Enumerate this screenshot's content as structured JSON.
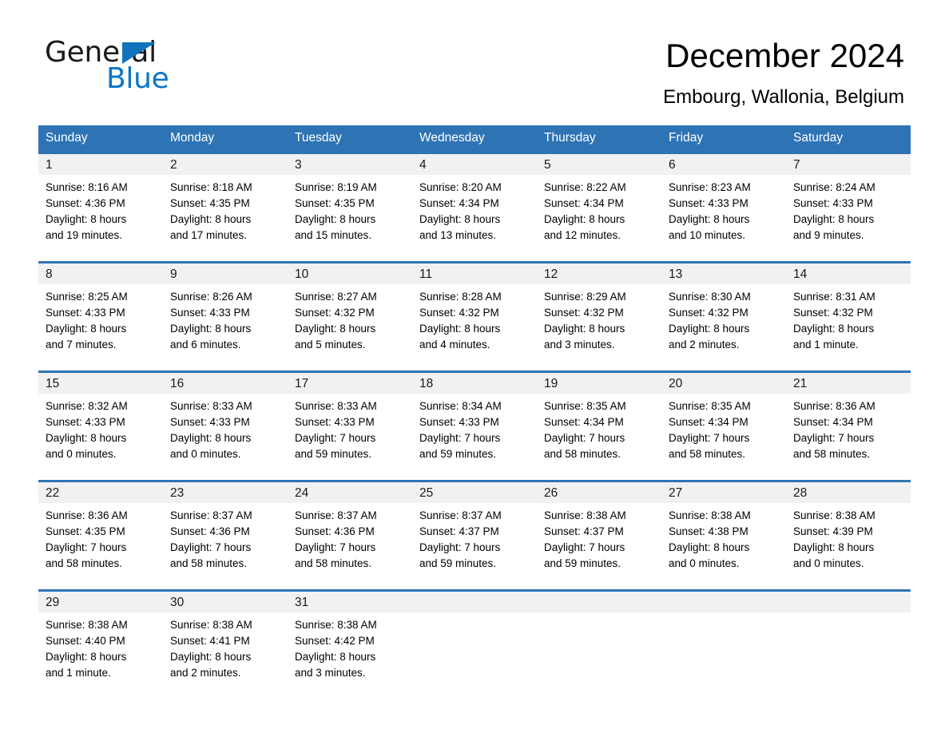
{
  "logo": {
    "word_one": "General",
    "word_two": "Blue",
    "triangle_color": "#1273bd",
    "blue_color": "#0b76c6"
  },
  "header": {
    "month_title": "December 2024",
    "location": "Embourg, Wallonia, Belgium"
  },
  "theme": {
    "header_blue": "#2e74b5",
    "daynum_band": "#f1f1f1",
    "text": "#000000"
  },
  "weekdays": [
    "Sunday",
    "Monday",
    "Tuesday",
    "Wednesday",
    "Thursday",
    "Friday",
    "Saturday"
  ],
  "weeks": [
    [
      {
        "day": "1",
        "sunrise": "Sunrise: 8:16 AM",
        "sunset": "Sunset: 4:36 PM",
        "daylight_1": "Daylight: 8 hours",
        "daylight_2": "and 19 minutes."
      },
      {
        "day": "2",
        "sunrise": "Sunrise: 8:18 AM",
        "sunset": "Sunset: 4:35 PM",
        "daylight_1": "Daylight: 8 hours",
        "daylight_2": "and 17 minutes."
      },
      {
        "day": "3",
        "sunrise": "Sunrise: 8:19 AM",
        "sunset": "Sunset: 4:35 PM",
        "daylight_1": "Daylight: 8 hours",
        "daylight_2": "and 15 minutes."
      },
      {
        "day": "4",
        "sunrise": "Sunrise: 8:20 AM",
        "sunset": "Sunset: 4:34 PM",
        "daylight_1": "Daylight: 8 hours",
        "daylight_2": "and 13 minutes."
      },
      {
        "day": "5",
        "sunrise": "Sunrise: 8:22 AM",
        "sunset": "Sunset: 4:34 PM",
        "daylight_1": "Daylight: 8 hours",
        "daylight_2": "and 12 minutes."
      },
      {
        "day": "6",
        "sunrise": "Sunrise: 8:23 AM",
        "sunset": "Sunset: 4:33 PM",
        "daylight_1": "Daylight: 8 hours",
        "daylight_2": "and 10 minutes."
      },
      {
        "day": "7",
        "sunrise": "Sunrise: 8:24 AM",
        "sunset": "Sunset: 4:33 PM",
        "daylight_1": "Daylight: 8 hours",
        "daylight_2": "and 9 minutes."
      }
    ],
    [
      {
        "day": "8",
        "sunrise": "Sunrise: 8:25 AM",
        "sunset": "Sunset: 4:33 PM",
        "daylight_1": "Daylight: 8 hours",
        "daylight_2": "and 7 minutes."
      },
      {
        "day": "9",
        "sunrise": "Sunrise: 8:26 AM",
        "sunset": "Sunset: 4:33 PM",
        "daylight_1": "Daylight: 8 hours",
        "daylight_2": "and 6 minutes."
      },
      {
        "day": "10",
        "sunrise": "Sunrise: 8:27 AM",
        "sunset": "Sunset: 4:32 PM",
        "daylight_1": "Daylight: 8 hours",
        "daylight_2": "and 5 minutes."
      },
      {
        "day": "11",
        "sunrise": "Sunrise: 8:28 AM",
        "sunset": "Sunset: 4:32 PM",
        "daylight_1": "Daylight: 8 hours",
        "daylight_2": "and 4 minutes."
      },
      {
        "day": "12",
        "sunrise": "Sunrise: 8:29 AM",
        "sunset": "Sunset: 4:32 PM",
        "daylight_1": "Daylight: 8 hours",
        "daylight_2": "and 3 minutes."
      },
      {
        "day": "13",
        "sunrise": "Sunrise: 8:30 AM",
        "sunset": "Sunset: 4:32 PM",
        "daylight_1": "Daylight: 8 hours",
        "daylight_2": "and 2 minutes."
      },
      {
        "day": "14",
        "sunrise": "Sunrise: 8:31 AM",
        "sunset": "Sunset: 4:32 PM",
        "daylight_1": "Daylight: 8 hours",
        "daylight_2": "and 1 minute."
      }
    ],
    [
      {
        "day": "15",
        "sunrise": "Sunrise: 8:32 AM",
        "sunset": "Sunset: 4:33 PM",
        "daylight_1": "Daylight: 8 hours",
        "daylight_2": "and 0 minutes."
      },
      {
        "day": "16",
        "sunrise": "Sunrise: 8:33 AM",
        "sunset": "Sunset: 4:33 PM",
        "daylight_1": "Daylight: 8 hours",
        "daylight_2": "and 0 minutes."
      },
      {
        "day": "17",
        "sunrise": "Sunrise: 8:33 AM",
        "sunset": "Sunset: 4:33 PM",
        "daylight_1": "Daylight: 7 hours",
        "daylight_2": "and 59 minutes."
      },
      {
        "day": "18",
        "sunrise": "Sunrise: 8:34 AM",
        "sunset": "Sunset: 4:33 PM",
        "daylight_1": "Daylight: 7 hours",
        "daylight_2": "and 59 minutes."
      },
      {
        "day": "19",
        "sunrise": "Sunrise: 8:35 AM",
        "sunset": "Sunset: 4:34 PM",
        "daylight_1": "Daylight: 7 hours",
        "daylight_2": "and 58 minutes."
      },
      {
        "day": "20",
        "sunrise": "Sunrise: 8:35 AM",
        "sunset": "Sunset: 4:34 PM",
        "daylight_1": "Daylight: 7 hours",
        "daylight_2": "and 58 minutes."
      },
      {
        "day": "21",
        "sunrise": "Sunrise: 8:36 AM",
        "sunset": "Sunset: 4:34 PM",
        "daylight_1": "Daylight: 7 hours",
        "daylight_2": "and 58 minutes."
      }
    ],
    [
      {
        "day": "22",
        "sunrise": "Sunrise: 8:36 AM",
        "sunset": "Sunset: 4:35 PM",
        "daylight_1": "Daylight: 7 hours",
        "daylight_2": "and 58 minutes."
      },
      {
        "day": "23",
        "sunrise": "Sunrise: 8:37 AM",
        "sunset": "Sunset: 4:36 PM",
        "daylight_1": "Daylight: 7 hours",
        "daylight_2": "and 58 minutes."
      },
      {
        "day": "24",
        "sunrise": "Sunrise: 8:37 AM",
        "sunset": "Sunset: 4:36 PM",
        "daylight_1": "Daylight: 7 hours",
        "daylight_2": "and 58 minutes."
      },
      {
        "day": "25",
        "sunrise": "Sunrise: 8:37 AM",
        "sunset": "Sunset: 4:37 PM",
        "daylight_1": "Daylight: 7 hours",
        "daylight_2": "and 59 minutes."
      },
      {
        "day": "26",
        "sunrise": "Sunrise: 8:38 AM",
        "sunset": "Sunset: 4:37 PM",
        "daylight_1": "Daylight: 7 hours",
        "daylight_2": "and 59 minutes."
      },
      {
        "day": "27",
        "sunrise": "Sunrise: 8:38 AM",
        "sunset": "Sunset: 4:38 PM",
        "daylight_1": "Daylight: 8 hours",
        "daylight_2": "and 0 minutes."
      },
      {
        "day": "28",
        "sunrise": "Sunrise: 8:38 AM",
        "sunset": "Sunset: 4:39 PM",
        "daylight_1": "Daylight: 8 hours",
        "daylight_2": "and 0 minutes."
      }
    ],
    [
      {
        "day": "29",
        "sunrise": "Sunrise: 8:38 AM",
        "sunset": "Sunset: 4:40 PM",
        "daylight_1": "Daylight: 8 hours",
        "daylight_2": "and 1 minute."
      },
      {
        "day": "30",
        "sunrise": "Sunrise: 8:38 AM",
        "sunset": "Sunset: 4:41 PM",
        "daylight_1": "Daylight: 8 hours",
        "daylight_2": "and 2 minutes."
      },
      {
        "day": "31",
        "sunrise": "Sunrise: 8:38 AM",
        "sunset": "Sunset: 4:42 PM",
        "daylight_1": "Daylight: 8 hours",
        "daylight_2": "and 3 minutes."
      },
      {
        "day": "",
        "sunrise": "",
        "sunset": "",
        "daylight_1": "",
        "daylight_2": ""
      },
      {
        "day": "",
        "sunrise": "",
        "sunset": "",
        "daylight_1": "",
        "daylight_2": ""
      },
      {
        "day": "",
        "sunrise": "",
        "sunset": "",
        "daylight_1": "",
        "daylight_2": ""
      },
      {
        "day": "",
        "sunrise": "",
        "sunset": "",
        "daylight_1": "",
        "daylight_2": ""
      }
    ]
  ]
}
